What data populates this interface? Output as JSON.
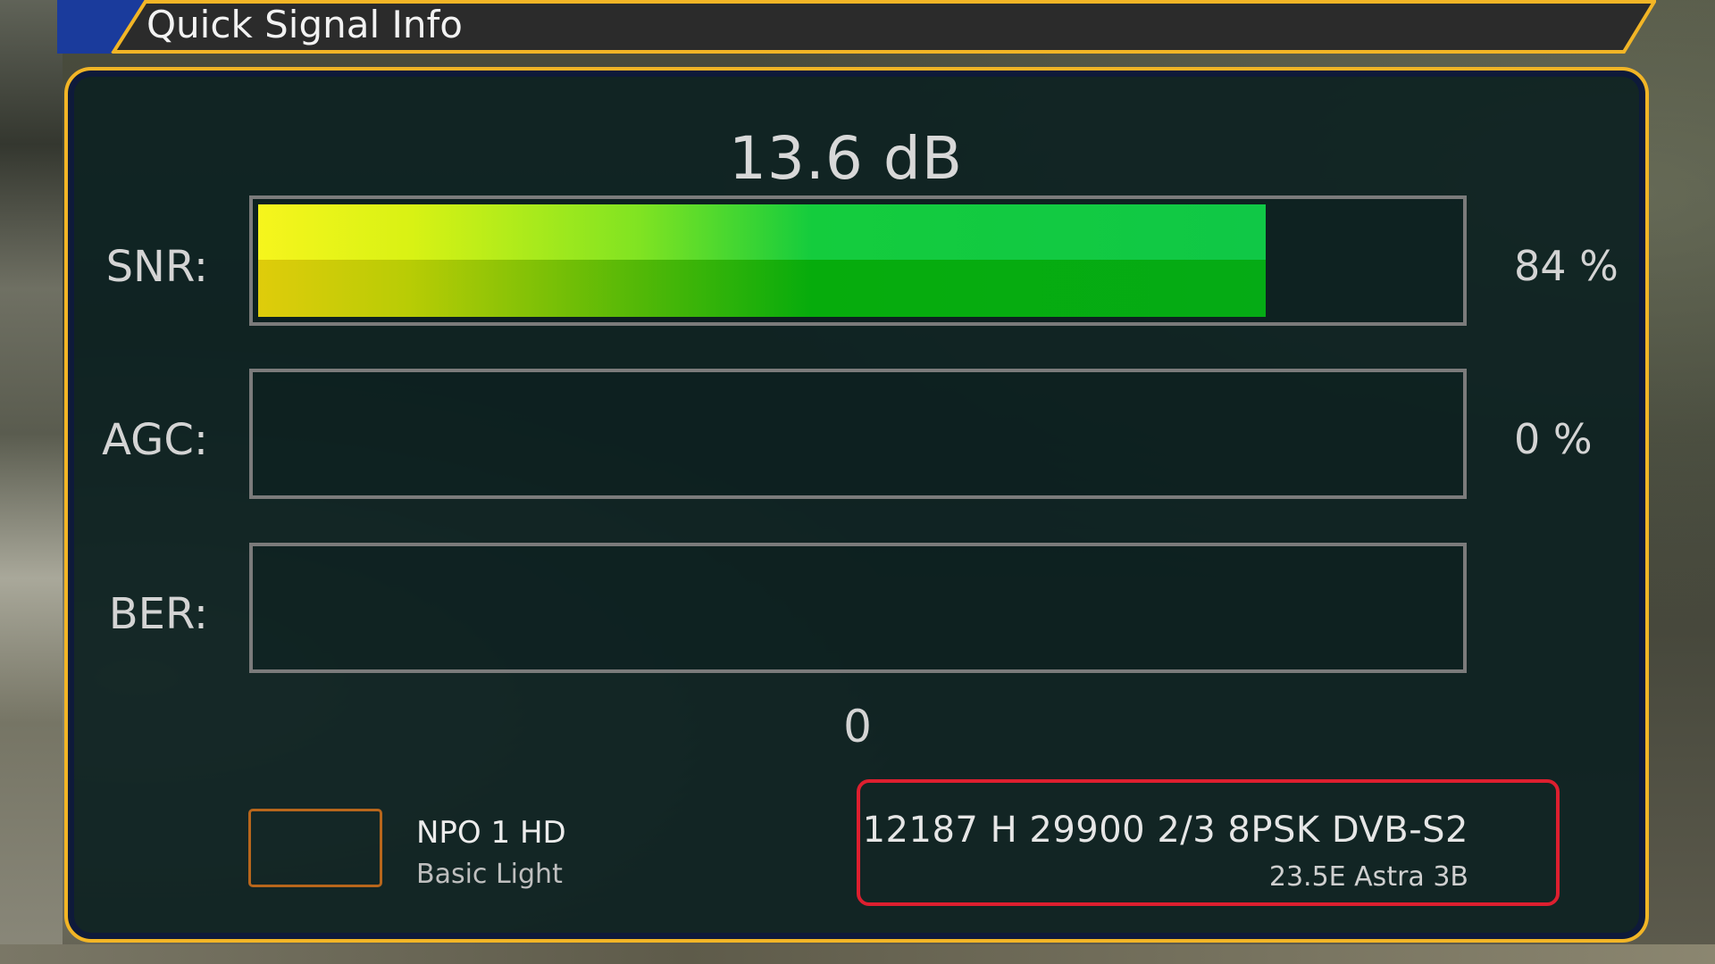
{
  "header": {
    "title": "Quick Signal Info"
  },
  "snr_db_text": "13.6 dB",
  "meters": [
    {
      "label": "SNR:",
      "percent": 84,
      "value_text": "84 %"
    },
    {
      "label": "AGC:",
      "percent": 0,
      "value_text": "0 %"
    },
    {
      "label": "BER:",
      "percent": 0,
      "value_text": ""
    }
  ],
  "ber_value": "0",
  "channel": {
    "name": "NPO 1 HD",
    "provider": "Basic Light"
  },
  "tuning": {
    "params": "12187 H 29900 2/3 8PSK DVB-S2",
    "satellite": "23.5E Astra 3B"
  },
  "colors": {
    "frame_accent": "#f2b526",
    "header_accent": "#1a3b9c",
    "tuning_border": "#dd1f2f",
    "logo_border": "#b8661c"
  }
}
